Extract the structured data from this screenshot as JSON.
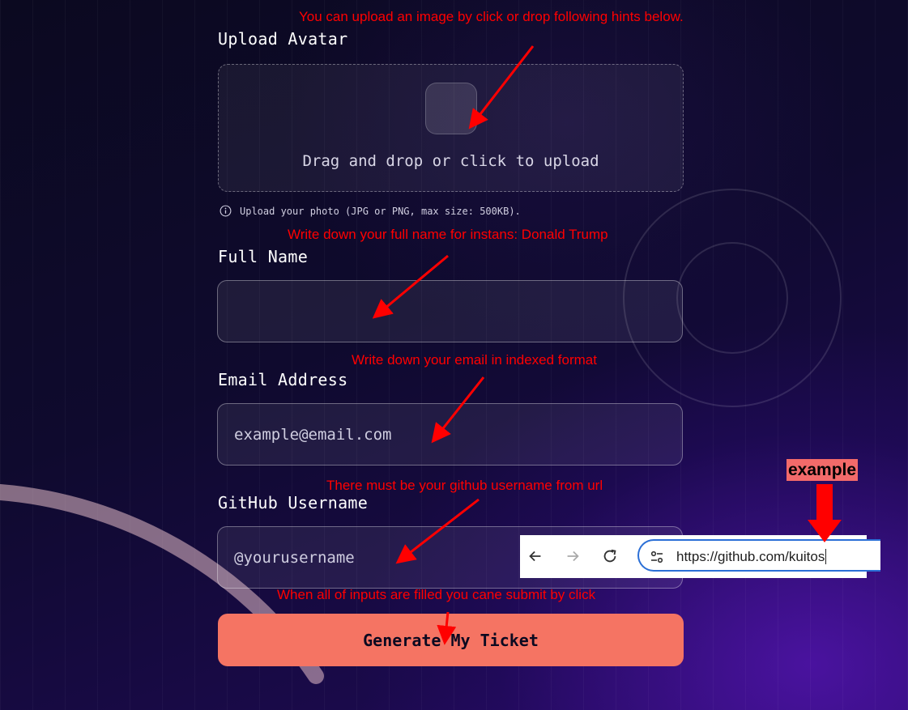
{
  "avatar": {
    "label": "Upload Avatar",
    "dropzone_text": "Drag and drop or click to upload",
    "hint": "Upload your photo (JPG or PNG, max size: 500KB).",
    "hint_icon": "info-icon",
    "upload_icon": "upload-icon"
  },
  "full_name": {
    "label": "Full Name",
    "value": "",
    "placeholder": ""
  },
  "email": {
    "label": "Email Address",
    "value": "",
    "placeholder": "example@email.com"
  },
  "github": {
    "label": "GitHub Username",
    "value": "",
    "placeholder": "@yourusername"
  },
  "submit": {
    "label": "Generate My Ticket"
  },
  "annotations": {
    "avatar": "You can upload an image by click or drop following hints below.",
    "full_name": "Write down your full name for instans: Donald Trump",
    "email": "Write down your email in indexed format",
    "github": "There must be your github username from url",
    "submit": "When all of inputs are filled you cane submit by click",
    "example": "example",
    "color": "#ff0000"
  },
  "example_browser": {
    "url": "https://github.com/kuitos",
    "icons": [
      "back-icon",
      "forward-icon",
      "reload-icon",
      "site-settings-icon"
    ]
  },
  "colors": {
    "accent": "#f57463",
    "background": "#0b0920",
    "annotation": "#ff0000"
  }
}
